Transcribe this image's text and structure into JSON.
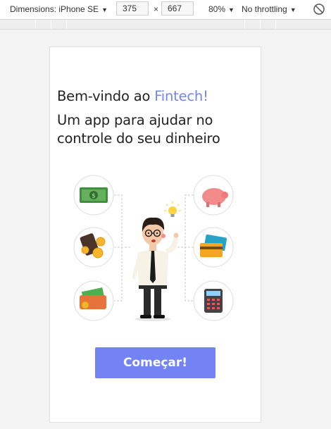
{
  "toolbar": {
    "device_label": "Dimensions: iPhone SE",
    "width_value": "375",
    "height_value": "667",
    "separator": "×",
    "zoom": "80%",
    "throttling": "No throttling",
    "icons": {
      "dropdown": "chevron-down-icon",
      "rotate": "rotate-icon"
    }
  },
  "page": {
    "greeting": "Bem-vindo ao ",
    "brand": "Fintech!",
    "subtitle": "Um app para ajudar no controle do seu dinheiro",
    "cta_label": "Começar!",
    "illustration": {
      "left_icons": [
        "cash-icon",
        "wallet-coins-icon",
        "money-wallet-icon"
      ],
      "right_icons": [
        "piggy-bank-icon",
        "credit-cards-icon",
        "calculator-icon"
      ],
      "center": "businessman-icon",
      "idea": "light-bulb-icon"
    }
  },
  "colors": {
    "accent": "#7383f3",
    "text": "#222222",
    "background": "#f3f3f3"
  }
}
